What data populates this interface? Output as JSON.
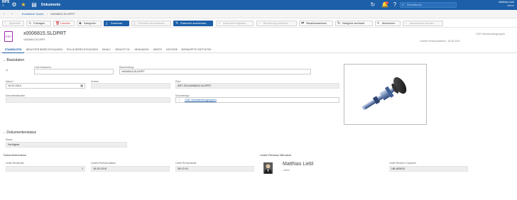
{
  "topbar": {
    "logo_text": "RPS",
    "app_title": "Dokumente",
    "search_placeholder": "Schnellsuche",
    "notification_count": "5",
    "user_name": "Matthias Liebl",
    "user_role": "admin",
    "icons": [
      "menu-icon",
      "star-icon",
      "history-icon",
      "bell-icon",
      "help-icon"
    ]
  },
  "breadcrumb": {
    "back_label": "‹",
    "forward_label": "›",
    "parent": "Erweiterte Suche",
    "separator": "›",
    "current": "x0006815.SLDPRT"
  },
  "toolbar": {
    "save": "Speichern",
    "attachments": "0 Anlagen",
    "delete": "Löschen",
    "categories": "Kategorien",
    "download": "Download",
    "revise_download": "Revisiös herunterladen",
    "checkout_document": "Dokument auschecken",
    "release_document": "Dokument freigeben",
    "unlock": "Blockierung aufheben",
    "situation_change": "Situationswechsel",
    "change_category": "Kategorie wechseln",
    "subscribe": "Abonnieren",
    "unsubscribe": "Abonnement löschen"
  },
  "document": {
    "icon_label": "PRT",
    "title": "x0006815.SLDPRT",
    "subtitle": "x0006815.SLDPRT",
    "doc_type": "CAD Standardbaugruppen",
    "last_revision": "Letztes Revisionsdatum: 18.05.2018"
  },
  "tabs": [
    {
      "label": "STAMMDATEN"
    },
    {
      "label": "BENUTZER BERECHTIGUNGEN"
    },
    {
      "label": "ROLLE BERECHTIGUNGEN"
    },
    {
      "label": "INHALT"
    },
    {
      "label": "BENUTZT IN"
    },
    {
      "label": "MENUNGEN"
    },
    {
      "label": "WERTE"
    },
    {
      "label": "HISTORIE"
    },
    {
      "label": "VERKNÜPFTE ENTITÄTEN"
    }
  ],
  "basisdaten": {
    "section_title": "Basisdaten",
    "code_label": "Code Dokument",
    "code_value": "",
    "description_label": "Beschreibung",
    "description_value": "x0006815.SLDPRT",
    "date_label": "Datum *",
    "date_value": "19.02.2014",
    "version_label": "Version",
    "version_value": "",
    "path_label": "Pfad",
    "path_value": "ART-ZD\\x0006815.SLDPRT",
    "situation_label": "Dokumentsituation",
    "situation_value": "",
    "doctype_label": "Dokumenttyp",
    "doctype_value": "CAD Standardbaugruppen"
  },
  "status": {
    "section_title": "Dokumentenstatus",
    "status_label": "Status",
    "status_value": "Verfügbar"
  },
  "revision": {
    "section_title": "Dokumentrevision",
    "last_rev_label": "Letzte Revisionen",
    "last_rev_value": "1",
    "last_rev_date_label": "Letztes Revisionsdatum",
    "last_rev_date_value": "18.05.2018",
    "last_rev_time_label": "Letzte Revisionszeit",
    "last_rev_time_value": "06:12:03",
    "last_user_title": "Letzte Revision Benutzer",
    "user_name": "Matthias Liebl",
    "user_role": "admin",
    "last_computer_label": "Letzte Revision Computer",
    "last_computer_value": "NB-ABW10"
  },
  "colors": {
    "topbar": "#1d5fa8",
    "accent": "#1d5fa8",
    "delete": "#d32f2f",
    "doc_icon": "#9c27b0"
  }
}
